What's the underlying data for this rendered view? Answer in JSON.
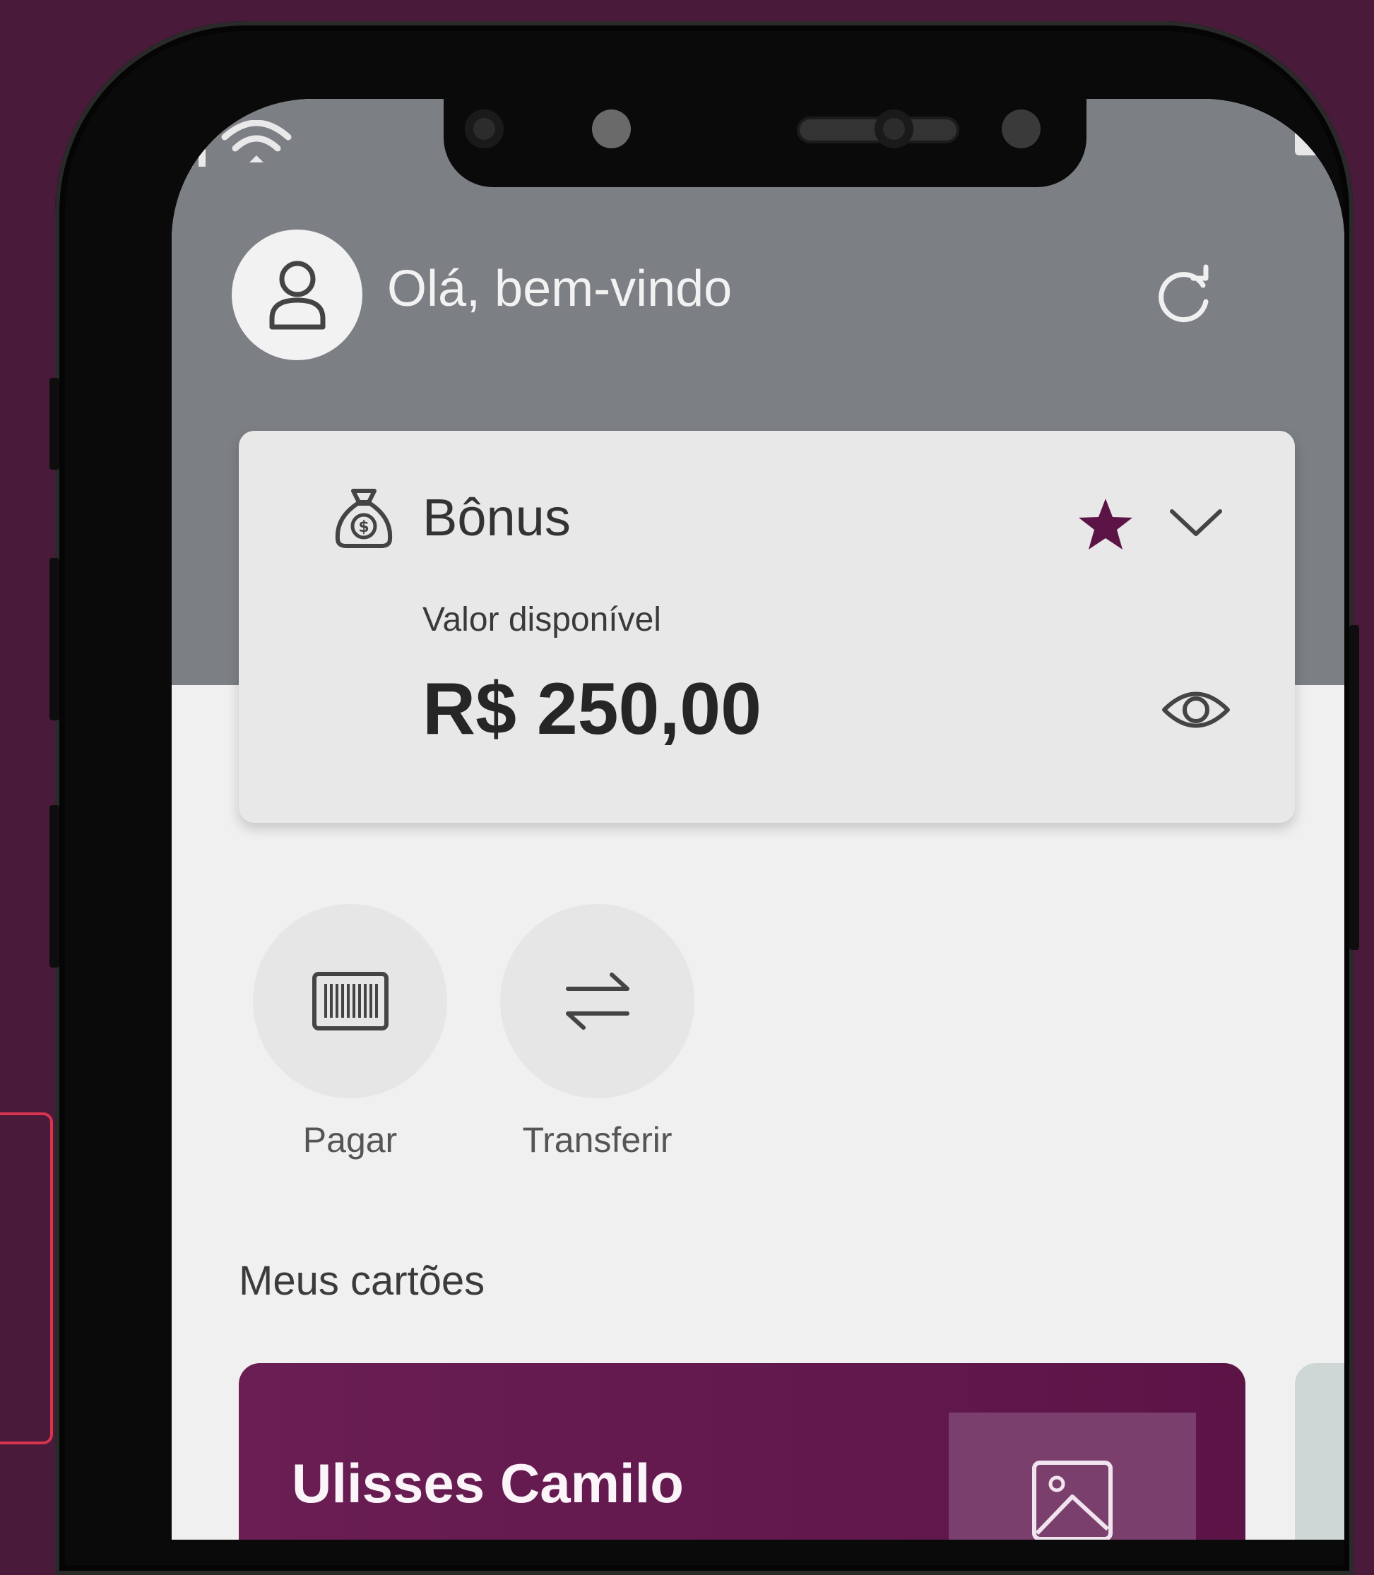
{
  "header": {
    "greeting": "Olá, bem-vindo"
  },
  "balance_card": {
    "title": "Bônus",
    "label": "Valor disponível",
    "value": "R$ 250,00",
    "favorite": true
  },
  "actions": [
    {
      "label": "Pagar",
      "icon": "barcode-icon"
    },
    {
      "label": "Transferir",
      "icon": "transfer-icon"
    }
  ],
  "cards_section": {
    "title": "Meus cartões",
    "card_holder": "Ulisses Camilo"
  },
  "colors": {
    "background": "#4a1a3a",
    "accent": "#5c1447",
    "header": "#7c7f84",
    "screen": "#f0f0f0"
  }
}
